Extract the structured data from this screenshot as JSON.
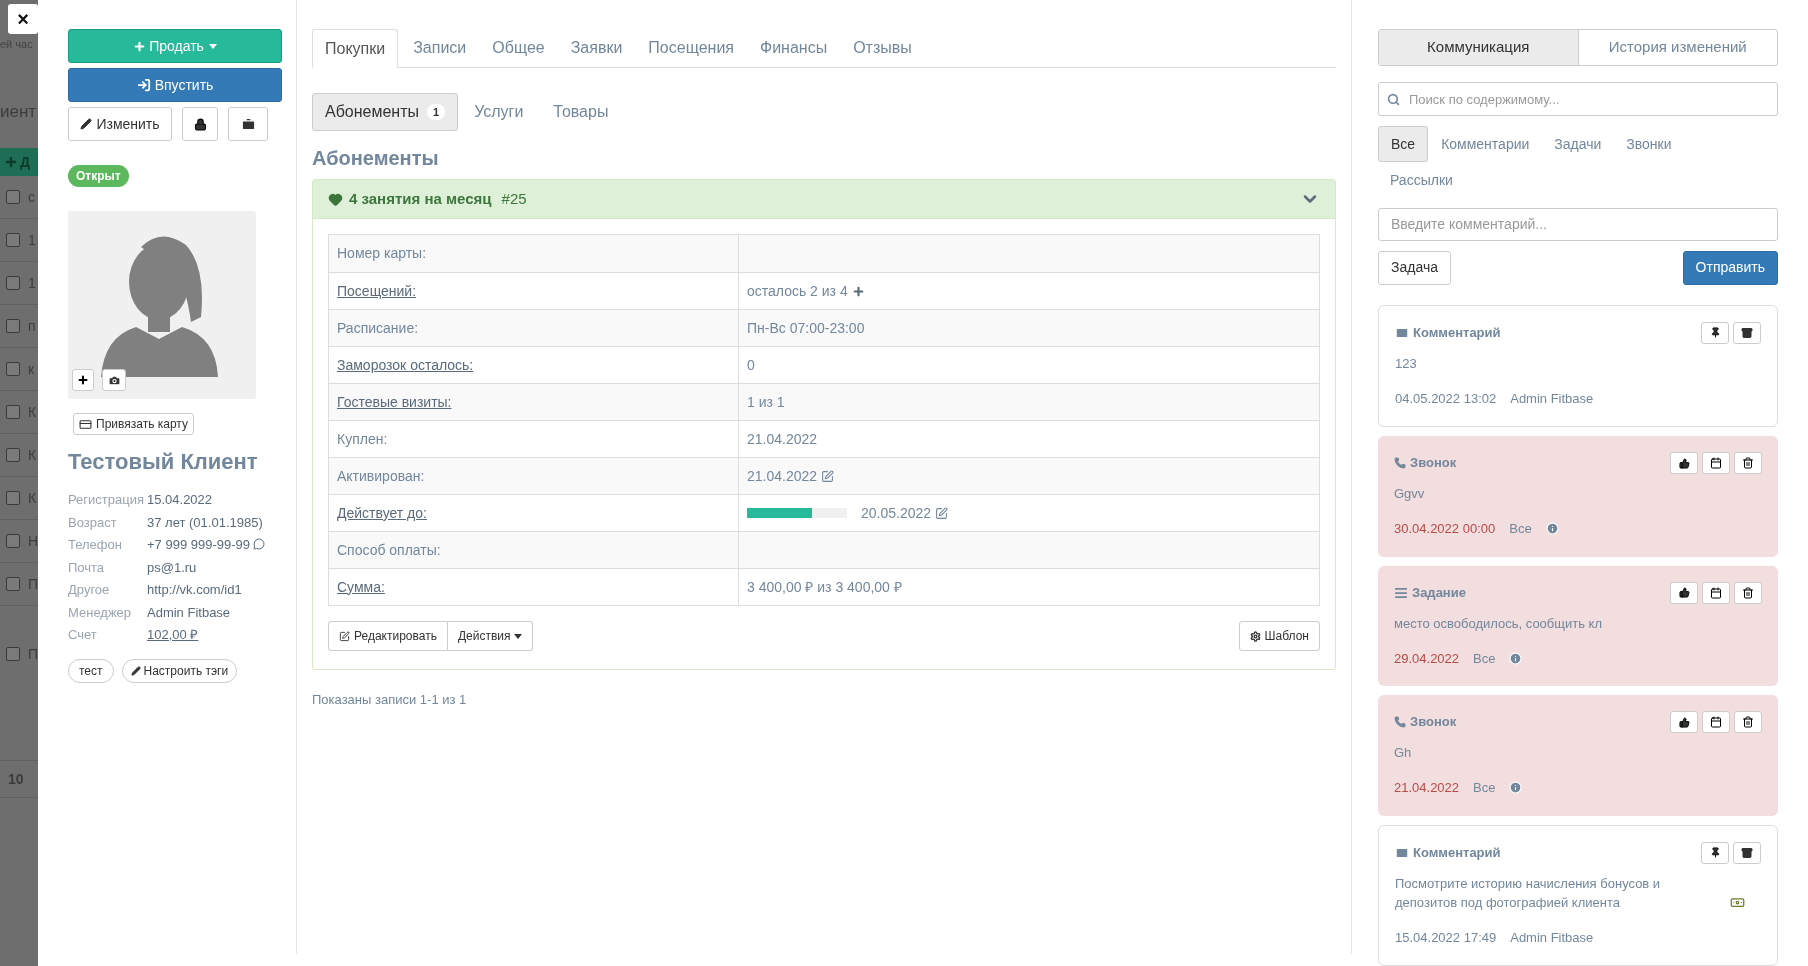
{
  "backdrop": {
    "top_fragment": "ей час",
    "header_fragment": "иент",
    "button_fragment": "Д",
    "rows": [
      {
        "text": "с",
        "checked": false
      },
      {
        "text": "1",
        "checked": false
      },
      {
        "text": "1",
        "checked": false
      },
      {
        "text": "п",
        "checked": false
      },
      {
        "text": "к",
        "checked": false
      },
      {
        "text": "К",
        "checked": false
      },
      {
        "text": "К",
        "checked": false
      },
      {
        "text": "К",
        "checked": false
      },
      {
        "text": "Н",
        "checked": false
      },
      {
        "text": "П",
        "checked": false
      }
    ],
    "last_row": {
      "text": "П",
      "checked": false
    },
    "footer_fragment": "10"
  },
  "close_button": "×",
  "profile": {
    "actions": {
      "sell": "Продать",
      "admit": "Впустить",
      "edit": "Изменить"
    },
    "status": "Открыт",
    "bind_card": "Привязать карту",
    "name": "Тестовый Клиент",
    "info": [
      {
        "label": "Регистрация",
        "value": "15.04.2022",
        "kind": "text"
      },
      {
        "label": "Возраст",
        "value": "37 лет (01.01.1985)",
        "kind": "text"
      },
      {
        "label": "Телефон",
        "value": "+7 999 999-99-99",
        "kind": "phone"
      },
      {
        "label": "Почта",
        "value": "ps@1.ru",
        "kind": "text"
      },
      {
        "label": "Другое",
        "value": "http://vk.com/id1",
        "kind": "text"
      },
      {
        "label": "Менеджер",
        "value": "Admin Fitbase",
        "kind": "text"
      },
      {
        "label": "Счет",
        "value": "102,00 ₽",
        "kind": "link"
      }
    ],
    "tags": [
      "тест"
    ],
    "tags_button": "Настроить тэги"
  },
  "tabs": [
    {
      "label": "Покупки",
      "selected": true
    },
    {
      "label": "Записи",
      "selected": false
    },
    {
      "label": "Общее",
      "selected": false
    },
    {
      "label": "Заявки",
      "selected": false
    },
    {
      "label": "Посещения",
      "selected": false
    },
    {
      "label": "Финансы",
      "selected": false
    },
    {
      "label": "Отзывы",
      "selected": false
    }
  ],
  "subtabs": [
    {
      "label": "Абонементы",
      "count": "1",
      "selected": true
    },
    {
      "label": "Услуги",
      "selected": false
    },
    {
      "label": "Товары",
      "selected": false
    }
  ],
  "section_title": "Абонементы",
  "membership": {
    "title": "4 занятия на месяц",
    "number": "#25",
    "rows": [
      {
        "label": "Номер карты:",
        "link": false,
        "value": "",
        "kind": "plain"
      },
      {
        "label": "Посещений:",
        "link": true,
        "value": "осталось 2 из 4",
        "kind": "add"
      },
      {
        "label": "Расписание:",
        "link": false,
        "value": "Пн-Вс 07:00-23:00",
        "kind": "plain"
      },
      {
        "label": "Заморозок осталось:",
        "link": true,
        "value": "0",
        "kind": "plain"
      },
      {
        "label": "Гостевые визиты:",
        "link": true,
        "value": "1 из 1",
        "kind": "plain"
      },
      {
        "label": "Куплен:",
        "link": false,
        "value": "21.04.2022",
        "kind": "plain"
      },
      {
        "label": "Активирован:",
        "link": false,
        "value": "21.04.2022",
        "kind": "edit"
      },
      {
        "label": "Действует до:",
        "link": true,
        "value": "20.05.2022",
        "kind": "progress",
        "level": 0.65
      },
      {
        "label": "Способ оплаты:",
        "link": false,
        "value": "",
        "kind": "plain"
      },
      {
        "label": "Сумма:",
        "link": true,
        "value": "3 400,00 ₽ из 3 400,00 ₽",
        "kind": "plain"
      }
    ],
    "edit_button": "Редактировать",
    "actions_button": "Действия",
    "template_button": "Шаблон"
  },
  "records_info": "Показаны записи 1-1 из 1",
  "right_tabs": [
    {
      "label": "Коммуникация",
      "selected": true
    },
    {
      "label": "История изменений",
      "selected": false
    }
  ],
  "search": {
    "placeholder": "Поиск по содержимому..."
  },
  "filters": [
    {
      "label": "Все",
      "selected": true
    },
    {
      "label": "Комментарии",
      "selected": false
    },
    {
      "label": "Задачи",
      "selected": false
    },
    {
      "label": "Звонки",
      "selected": false
    },
    {
      "label": "Рассылки",
      "selected": false
    }
  ],
  "comment_input": {
    "placeholder": "Введите комментарий..."
  },
  "task_button": "Задача",
  "send_button": "Отправить",
  "feed": [
    {
      "kind": "comment",
      "title": "Комментарий",
      "body": "123",
      "date": "04.05.2022 13:02",
      "author": "Admin Fitbase",
      "overdue": false
    },
    {
      "kind": "call",
      "title": "Звонок",
      "body": "Ggvv",
      "date": "30.04.2022 00:00",
      "author": "Все",
      "overdue": true
    },
    {
      "kind": "task",
      "title": "Задание",
      "body": "место освободилось, сообщить кл",
      "date": "29.04.2022",
      "author": "Все",
      "overdue": true
    },
    {
      "kind": "call",
      "title": "Звонок",
      "body": "Gh",
      "date": "21.04.2022",
      "author": "Все",
      "overdue": true
    },
    {
      "kind": "comment",
      "title": "Комментарий",
      "body": "Посмотрите историю начисления бонусов и депозитов под фотографией клиента",
      "date": "15.04.2022 17:49",
      "author": "Admin Fitbase",
      "overdue": false,
      "note_icon": true
    }
  ]
}
